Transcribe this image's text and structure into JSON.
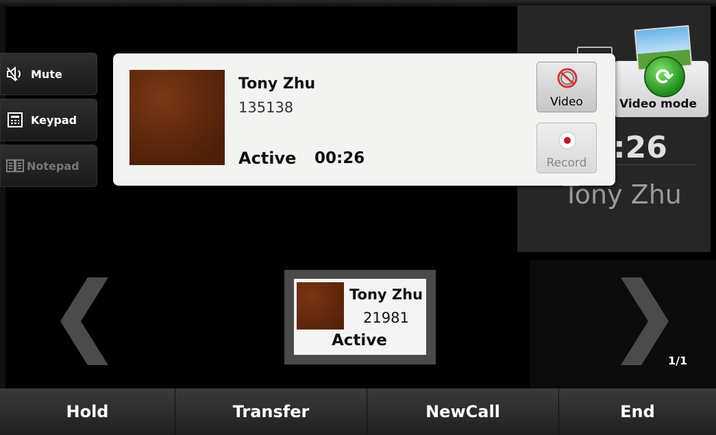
{
  "side_buttons": [
    {
      "label": "Mute",
      "icon": "mute-icon",
      "enabled": true
    },
    {
      "label": "Keypad",
      "icon": "keypad-icon",
      "enabled": true
    },
    {
      "label": "Notepad",
      "icon": "notepad-icon",
      "enabled": false
    }
  ],
  "popup": {
    "name": "Tony Zhu",
    "number": "135138",
    "status": "Active",
    "duration": "00:26",
    "video_label": "Video",
    "record_label": "Record"
  },
  "right_panel": {
    "video_mode_label": "Video mode",
    "timer_partial": ":26",
    "name": "Tony Zhu",
    "page_indicator": "1/1"
  },
  "small_card": {
    "name": "Tony Zhu",
    "number": "21981",
    "status": "Active"
  },
  "softkeys": [
    "Hold",
    "Transfer",
    "NewCall",
    "End"
  ]
}
